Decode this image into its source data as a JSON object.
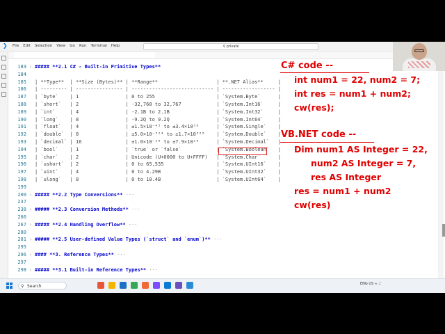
{
  "titlebar": {
    "menu": [
      "File",
      "Edit",
      "Selection",
      "View",
      "Go",
      "Run",
      "Terminal",
      "Help"
    ],
    "search_text": "private"
  },
  "editor": {
    "lines": [
      {
        "n": "183",
        "kind": "h",
        "text": "##### **2.1 C# - Built-in Primitive Types**"
      },
      {
        "n": "184",
        "kind": "p",
        "text": ""
      },
      {
        "n": "185",
        "kind": "p",
        "text": "| **Type**  | **Size (Bytes)** | **Range**                    | **.NET Alias**     |"
      },
      {
        "n": "186",
        "kind": "p",
        "text": "| --------- | ---------------- | ---------------------------- | ------------------ |"
      },
      {
        "n": "187",
        "kind": "p",
        "text": "| `byte`    | 1                | 0 to 255                     | `System.Byte`      |"
      },
      {
        "n": "188",
        "kind": "p",
        "text": "| `short`   | 2                | -32,768 to 32,767            | `System.Int16`     |"
      },
      {
        "n": "189",
        "kind": "p",
        "text": "| `int`     | 4                | -2.1B to 2.1B                | `System.Int32`     |"
      },
      {
        "n": "190",
        "kind": "p",
        "text": "| `long`    | 8                | -9.2Q to 9.2Q                | `System.Int64`     |"
      },
      {
        "n": "191",
        "kind": "p",
        "text": "| `float`   | 4                | ±1.5×10⁻⁴⁵ to ±3.4×10³⁸      | `System.Single`    |"
      },
      {
        "n": "192",
        "kind": "p",
        "text": "| `double`  | 8                | ±5.0×10⁻³²⁴ to ±1.7×10³⁰⁸    | `System.Double`    |"
      },
      {
        "n": "193",
        "kind": "p",
        "text": "| `decimal` | 16               | ±1.0×10⁻²⁸ to ±7.9×10²⁸      | `System.Decimal`   |"
      },
      {
        "n": "194",
        "kind": "p",
        "text": "| `bool`    | 1                | `true` or `false`            | `System.Boolean`   |"
      },
      {
        "n": "195",
        "kind": "p",
        "text": "| `char`    | 2                | Unicode (U+0000 to U+FFFF)   | `System.Char`      |"
      },
      {
        "n": "196",
        "kind": "p",
        "text": "| `ushort`  | 2                | 0 to 65,535                  | `System.UInt16`    |"
      },
      {
        "n": "197",
        "kind": "p",
        "text": "| `uint`    | 4                | 0 to 4.29B                   | `System.UInt32`    |"
      },
      {
        "n": "198",
        "kind": "p",
        "text": "| `ulong`   | 8                | 0 to 18.4B                   | `System.UInt64`    |"
      },
      {
        "n": "199",
        "kind": "p",
        "text": ""
      },
      {
        "n": "200",
        "kind": "h",
        "text": "##### **2.2 Type Conversions**"
      },
      {
        "n": "237",
        "kind": "p",
        "text": ""
      },
      {
        "n": "238",
        "kind": "h",
        "text": "##### **2.3 Conversion Methods**"
      },
      {
        "n": "266",
        "kind": "p",
        "text": ""
      },
      {
        "n": "267",
        "kind": "h",
        "text": "##### **2.4 Handling Overflow**"
      },
      {
        "n": "280",
        "kind": "p",
        "text": ""
      },
      {
        "n": "281",
        "kind": "h",
        "text": "##### **2.5 User-defined Value Types (`struct` and `enum`)**"
      },
      {
        "n": "295",
        "kind": "p",
        "text": ""
      },
      {
        "n": "296",
        "kind": "h",
        "text": "#### **3. Reference Types**"
      },
      {
        "n": "297",
        "kind": "p",
        "text": ""
      },
      {
        "n": "298",
        "kind": "h",
        "text": "##### **3.1 Built-in Reference Types**"
      }
    ]
  },
  "overlay": {
    "cs_heading": "C# code --",
    "cs_lines": [
      "int num1 = 22, num2 = 7;",
      "int res = num1 + num2;",
      "cw(res);"
    ],
    "vb_heading": "VB.NET code --",
    "vb_lines": [
      "Dim num1 AS Integer = 22,",
      "num2 AS Integer = 7,",
      "res AS Integer",
      "res = num1 + num2",
      "cw(res)"
    ]
  },
  "taskbar": {
    "search_label": "Search",
    "tray_text": "ENG US",
    "icon_colors": [
      "#e8563a",
      "#f4b400",
      "#1d6fc4",
      "#34a853",
      "#f06a35",
      "#7c4dff",
      "#0a7ad6",
      "#6b4fbb",
      "#2b8ad6"
    ]
  }
}
